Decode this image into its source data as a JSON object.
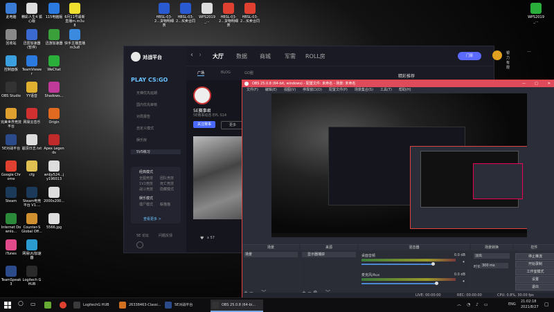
{
  "desktop": {
    "col1": [
      {
        "label": "此电脑",
        "icon": "computer-icon",
        "color": "#3a7bd5"
      },
      {
        "label": "回收站",
        "icon": "recycle-bin-icon",
        "color": "#888"
      },
      {
        "label": "控制面板",
        "icon": "control-panel-icon",
        "color": "#3aa0e0"
      },
      {
        "label": "OBS Studio",
        "icon": "obs-icon",
        "color": "#333"
      },
      {
        "label": "完美世界竞技平台",
        "icon": "wanmei-icon",
        "color": "#e0a030"
      },
      {
        "label": "5E对战平台",
        "icon": "5e-icon",
        "color": "#2a4a8a"
      },
      {
        "label": "Google Chrome",
        "icon": "chrome-icon",
        "color": "#e04030"
      },
      {
        "label": "Steam",
        "icon": "steam-icon",
        "color": "#1b3a5a"
      },
      {
        "label": "Internet Downlo...",
        "icon": "idm-icon",
        "color": "#2a8a3a"
      },
      {
        "label": "iTunes",
        "icon": "itunes-icon",
        "color": "#e04a8a"
      },
      {
        "label": "TeamSpeak 3",
        "icon": "teamspeak-icon",
        "color": "#2a4a8a"
      }
    ],
    "col2": [
      {
        "label": "精彩人生4 狐心版",
        "icon": "document-icon",
        "color": "#ddd"
      },
      {
        "label": "迅雷加速器(暂停)",
        "icon": "accelerator-icon",
        "color": "#3a6ad0"
      },
      {
        "label": "TeamViewer",
        "icon": "teamviewer-icon",
        "color": "#2a7ae0"
      },
      {
        "label": "YY语音",
        "icon": "yy-icon",
        "color": "#e0b030"
      },
      {
        "label": "网易云音乐",
        "icon": "netease-music-icon",
        "color": "#d03030"
      },
      {
        "label": "崩溃日志.txt",
        "icon": "text-file-icon",
        "color": "#ddd"
      },
      {
        "label": "cfg",
        "icon": "folder-icon",
        "color": "#e0c050"
      },
      {
        "label": "Steam电竞平台 V1....",
        "icon": "steam-icon",
        "color": "#1b3a5a"
      },
      {
        "label": "Counter-S Global Off...",
        "icon": "csgo-icon",
        "color": "#d09030"
      },
      {
        "label": "网易UU加速器",
        "icon": "uu-icon",
        "color": "#2a9ad0"
      },
      {
        "label": "Logitech G HUB",
        "icon": "logitech-icon",
        "color": "#2a2a2a"
      }
    ],
    "col3": [
      {
        "label": "115电脑版",
        "icon": "115-icon",
        "color": "#2a7ae0"
      },
      {
        "label": "迅游加速器",
        "icon": "xunyou-icon",
        "color": "#3aa03a"
      },
      {
        "label": "WeChat",
        "icon": "wechat-icon",
        "color": "#2ab03a"
      },
      {
        "label": "Shadows...",
        "icon": "shadowsocks-icon",
        "color": "#c03a9a"
      },
      {
        "label": "Origin",
        "icon": "origin-icon",
        "color": "#e06a20"
      },
      {
        "label": "Apex Legends",
        "icon": "apex-icon",
        "color": "#c02a2a"
      },
      {
        "label": "wnljy524...jy196013",
        "icon": "document-icon",
        "color": "#ddd"
      },
      {
        "label": "2000x200...",
        "icon": "image-file-icon",
        "color": "#ddd"
      },
      {
        "label": "5566.jpg",
        "icon": "image-file-icon",
        "color": "#ddd"
      }
    ],
    "col4": [
      {
        "label": "6月11号最新直播m.m3u8",
        "icon": "media-file-icon",
        "color": "#f0e030"
      },
      {
        "label": "快手主播直播m3u8",
        "icon": "media-file-icon",
        "color": "#3a8ae0"
      }
    ],
    "top_row": [
      {
        "label": "HBSL-03-2...货物明细表",
        "icon": "word-icon",
        "color": "#2a5ad0"
      },
      {
        "label": "HBSL-03-2...买卖合同",
        "icon": "word-icon",
        "color": "#2a5ad0"
      },
      {
        "label": "WPS2019_...",
        "icon": "wps-icon",
        "color": "#ddd"
      },
      {
        "label": "HBSL-03-2...货物明细表",
        "icon": "chrome-icon",
        "color": "#e04030"
      },
      {
        "label": "HBSL-03-2...买卖合同",
        "icon": "chrome-icon",
        "color": "#e04030"
      }
    ],
    "top_right": {
      "label": "WPS2019_...",
      "icon": "wps-icon",
      "color": "#2ab03a"
    }
  },
  "app": {
    "logo": "对战平台",
    "tabs": [
      "大厅",
      "数据",
      "商城",
      "军需",
      "ROLL房"
    ],
    "sub_tabs": [
      "广场",
      "BLOG",
      "GO圈"
    ],
    "sidebar_title": "PLAY CS:GO",
    "sidebar_items": [
      "天梯优先延期",
      "国内优先审核",
      "对局报告",
      "自定义模式",
      "娱乐房",
      "5V5练习"
    ],
    "section1": "经典模式",
    "section1_items": [
      "全图竞技",
      "团队竞技",
      "1V1竞技",
      "死亡竞技",
      "战斗竞技",
      "隐藏模式"
    ],
    "section2": "娱乐模式",
    "section2_items": [
      "僵尸模式",
      "躲猫猫"
    ],
    "expand": "查看更多 >",
    "footer_left": "5E 论坛",
    "footer_right": "问题反馈",
    "profile_name": "5E赛事君",
    "profile_sub": "5E赛事动态 EPL S14",
    "btn_follow": "关注赛事",
    "btn_more": "更多",
    "right_title": "精彩推荐",
    "top_btn": "门票",
    "user": "银力有限",
    "likes": "57"
  },
  "obs": {
    "title": "OBS 25.0.8 (64-bit, windows) - 配置文件: 未命名 - 场景: 未命名",
    "menu": [
      "文件(F)",
      "编辑(E)",
      "视图(V)",
      "停靠窗口(D)",
      "配置文件(P)",
      "场景集合(S)",
      "工具(T)",
      "帮助(H)"
    ],
    "docks": {
      "scenes": "场景",
      "sources": "来源",
      "mixer": "混音器",
      "transitions": "场景转换",
      "controls": "控件"
    },
    "scene_item": "场景",
    "source_item": "显示器捕获",
    "mixer_tracks": [
      {
        "name": "桌面音频",
        "db": "0.0 dB",
        "level": 0.78
      },
      {
        "name": "麦克风/Aux",
        "db": "0.0 dB",
        "level": 0.82
      }
    ],
    "transition": "淡出",
    "duration_label": "时长",
    "duration": "300 ms",
    "controls": [
      "停止推流",
      "开始录制",
      "工作室模式",
      "设置",
      "退出"
    ],
    "status": {
      "live": "LIVE: 00:00:00",
      "rec": "REC: 00:00:00",
      "cpu": "CPU: 0.8%, 30.00 fps"
    }
  },
  "taskbar": {
    "items": [
      {
        "label": "LogitechG HUB",
        "icon": "logitech-icon",
        "color": "#3a3a3a",
        "active": false
      },
      {
        "label": "26338463-Classi...",
        "icon": "game-icon",
        "color": "#d07020",
        "active": false
      },
      {
        "label": "5E对战平台",
        "icon": "5e-icon",
        "color": "#2a4a8a",
        "active": false
      },
      {
        "label": "OBS 25.0.8 (64-bi...",
        "icon": "obs-icon",
        "color": "#333",
        "active": true
      }
    ],
    "ime": "ENG",
    "time": "21:02:18",
    "date": "2021/8/27"
  }
}
